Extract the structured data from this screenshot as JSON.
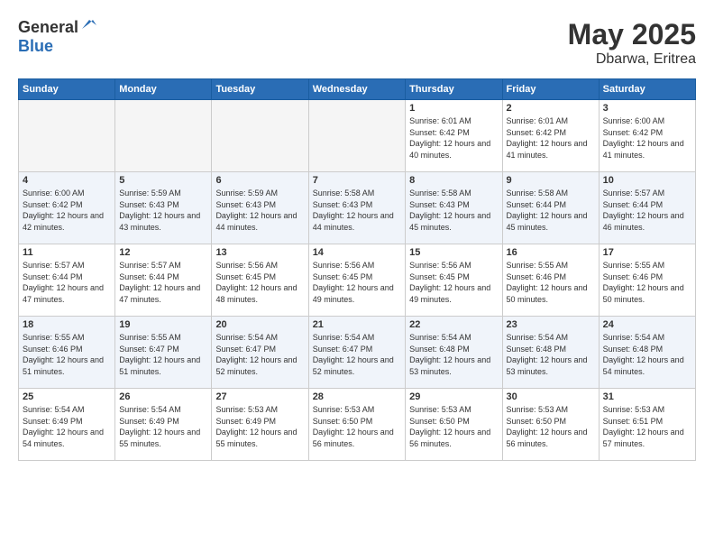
{
  "logo": {
    "general": "General",
    "blue": "Blue"
  },
  "header": {
    "month_year": "May 2025",
    "location": "Dbarwa, Eritrea"
  },
  "weekdays": [
    "Sunday",
    "Monday",
    "Tuesday",
    "Wednesday",
    "Thursday",
    "Friday",
    "Saturday"
  ],
  "weeks": [
    [
      {
        "day": "",
        "empty": true
      },
      {
        "day": "",
        "empty": true
      },
      {
        "day": "",
        "empty": true
      },
      {
        "day": "",
        "empty": true
      },
      {
        "day": "1",
        "sunrise": "6:01 AM",
        "sunset": "6:42 PM",
        "daylight": "12 hours and 40 minutes."
      },
      {
        "day": "2",
        "sunrise": "6:01 AM",
        "sunset": "6:42 PM",
        "daylight": "12 hours and 41 minutes."
      },
      {
        "day": "3",
        "sunrise": "6:00 AM",
        "sunset": "6:42 PM",
        "daylight": "12 hours and 41 minutes."
      }
    ],
    [
      {
        "day": "4",
        "sunrise": "6:00 AM",
        "sunset": "6:42 PM",
        "daylight": "12 hours and 42 minutes."
      },
      {
        "day": "5",
        "sunrise": "5:59 AM",
        "sunset": "6:43 PM",
        "daylight": "12 hours and 43 minutes."
      },
      {
        "day": "6",
        "sunrise": "5:59 AM",
        "sunset": "6:43 PM",
        "daylight": "12 hours and 44 minutes."
      },
      {
        "day": "7",
        "sunrise": "5:58 AM",
        "sunset": "6:43 PM",
        "daylight": "12 hours and 44 minutes."
      },
      {
        "day": "8",
        "sunrise": "5:58 AM",
        "sunset": "6:43 PM",
        "daylight": "12 hours and 45 minutes."
      },
      {
        "day": "9",
        "sunrise": "5:58 AM",
        "sunset": "6:44 PM",
        "daylight": "12 hours and 45 minutes."
      },
      {
        "day": "10",
        "sunrise": "5:57 AM",
        "sunset": "6:44 PM",
        "daylight": "12 hours and 46 minutes."
      }
    ],
    [
      {
        "day": "11",
        "sunrise": "5:57 AM",
        "sunset": "6:44 PM",
        "daylight": "12 hours and 47 minutes."
      },
      {
        "day": "12",
        "sunrise": "5:57 AM",
        "sunset": "6:44 PM",
        "daylight": "12 hours and 47 minutes."
      },
      {
        "day": "13",
        "sunrise": "5:56 AM",
        "sunset": "6:45 PM",
        "daylight": "12 hours and 48 minutes."
      },
      {
        "day": "14",
        "sunrise": "5:56 AM",
        "sunset": "6:45 PM",
        "daylight": "12 hours and 49 minutes."
      },
      {
        "day": "15",
        "sunrise": "5:56 AM",
        "sunset": "6:45 PM",
        "daylight": "12 hours and 49 minutes."
      },
      {
        "day": "16",
        "sunrise": "5:55 AM",
        "sunset": "6:46 PM",
        "daylight": "12 hours and 50 minutes."
      },
      {
        "day": "17",
        "sunrise": "5:55 AM",
        "sunset": "6:46 PM",
        "daylight": "12 hours and 50 minutes."
      }
    ],
    [
      {
        "day": "18",
        "sunrise": "5:55 AM",
        "sunset": "6:46 PM",
        "daylight": "12 hours and 51 minutes."
      },
      {
        "day": "19",
        "sunrise": "5:55 AM",
        "sunset": "6:47 PM",
        "daylight": "12 hours and 51 minutes."
      },
      {
        "day": "20",
        "sunrise": "5:54 AM",
        "sunset": "6:47 PM",
        "daylight": "12 hours and 52 minutes."
      },
      {
        "day": "21",
        "sunrise": "5:54 AM",
        "sunset": "6:47 PM",
        "daylight": "12 hours and 52 minutes."
      },
      {
        "day": "22",
        "sunrise": "5:54 AM",
        "sunset": "6:48 PM",
        "daylight": "12 hours and 53 minutes."
      },
      {
        "day": "23",
        "sunrise": "5:54 AM",
        "sunset": "6:48 PM",
        "daylight": "12 hours and 53 minutes."
      },
      {
        "day": "24",
        "sunrise": "5:54 AM",
        "sunset": "6:48 PM",
        "daylight": "12 hours and 54 minutes."
      }
    ],
    [
      {
        "day": "25",
        "sunrise": "5:54 AM",
        "sunset": "6:49 PM",
        "daylight": "12 hours and 54 minutes."
      },
      {
        "day": "26",
        "sunrise": "5:54 AM",
        "sunset": "6:49 PM",
        "daylight": "12 hours and 55 minutes."
      },
      {
        "day": "27",
        "sunrise": "5:53 AM",
        "sunset": "6:49 PM",
        "daylight": "12 hours and 55 minutes."
      },
      {
        "day": "28",
        "sunrise": "5:53 AM",
        "sunset": "6:50 PM",
        "daylight": "12 hours and 56 minutes."
      },
      {
        "day": "29",
        "sunrise": "5:53 AM",
        "sunset": "6:50 PM",
        "daylight": "12 hours and 56 minutes."
      },
      {
        "day": "30",
        "sunrise": "5:53 AM",
        "sunset": "6:50 PM",
        "daylight": "12 hours and 56 minutes."
      },
      {
        "day": "31",
        "sunrise": "5:53 AM",
        "sunset": "6:51 PM",
        "daylight": "12 hours and 57 minutes."
      }
    ]
  ]
}
